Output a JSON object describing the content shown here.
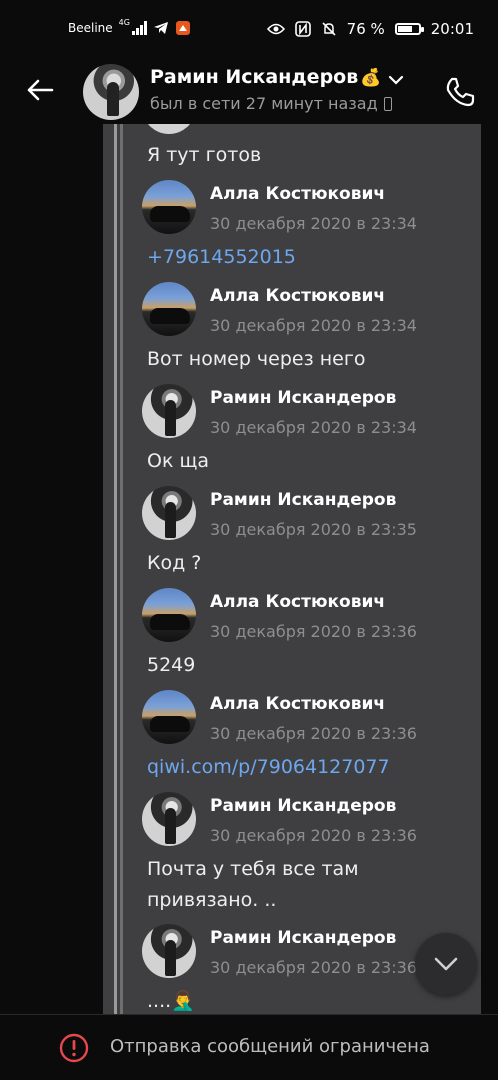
{
  "status_bar": {
    "carrier": "Beeline",
    "network_type": "4G",
    "battery_percent": "76 %",
    "battery_level": 0.76,
    "time": "20:01",
    "icons": [
      "signal-icon",
      "telegram-icon",
      "notification-icon",
      "eye-icon",
      "nfc-icon",
      "mute-icon",
      "battery-icon"
    ]
  },
  "header": {
    "contact_name": "Рамин Искандеров",
    "contact_emoji": "💰",
    "last_seen": "был в сети 27 минут назад"
  },
  "messages": [
    {
      "type": "text",
      "text": "Я тут готов"
    },
    {
      "type": "header",
      "sender": "Алла Костюкович",
      "date": "30 декабря 2020 в 23:34",
      "avatar": "alla"
    },
    {
      "type": "link",
      "text": "+79614552015"
    },
    {
      "type": "header",
      "sender": "Алла Костюкович",
      "date": "30 декабря 2020 в 23:34",
      "avatar": "alla"
    },
    {
      "type": "text",
      "text": "Вот номер через него"
    },
    {
      "type": "header",
      "sender": "Рамин Искандеров",
      "date": "30 декабря 2020 в 23:34",
      "avatar": "ramin"
    },
    {
      "type": "text",
      "text": "Ок ща"
    },
    {
      "type": "header",
      "sender": "Рамин Искандеров",
      "date": "30 декабря 2020 в 23:35",
      "avatar": "ramin"
    },
    {
      "type": "text",
      "text": "Код ?"
    },
    {
      "type": "header",
      "sender": "Алла Костюкович",
      "date": "30 декабря 2020 в 23:36",
      "avatar": "alla"
    },
    {
      "type": "text",
      "text": "5249"
    },
    {
      "type": "header",
      "sender": "Алла Костюкович",
      "date": "30 декабря 2020 в 23:36",
      "avatar": "alla"
    },
    {
      "type": "link",
      "text": "qiwi.com/p/79064127077"
    },
    {
      "type": "header",
      "sender": "Рамин Искандеров",
      "date": "30 декабря 2020 в 23:36",
      "avatar": "ramin"
    },
    {
      "type": "text",
      "text": "Почта у тебя все там"
    },
    {
      "type": "text",
      "text": "привязано. .."
    },
    {
      "type": "header",
      "sender": "Рамин Искандеров",
      "date": "30 декабря 2020 в 23:36",
      "avatar": "ramin"
    },
    {
      "type": "text",
      "text": "....🤦‍♂️"
    }
  ],
  "bottom_bar": {
    "restricted_text": "Отправка сообщений ограничена"
  },
  "colors": {
    "background": "#0b0b0b",
    "forward_panel": "#3f3f42",
    "link": "#6ea7ee",
    "muted_text": "#8e8e8e",
    "warning": "#e5484d"
  }
}
